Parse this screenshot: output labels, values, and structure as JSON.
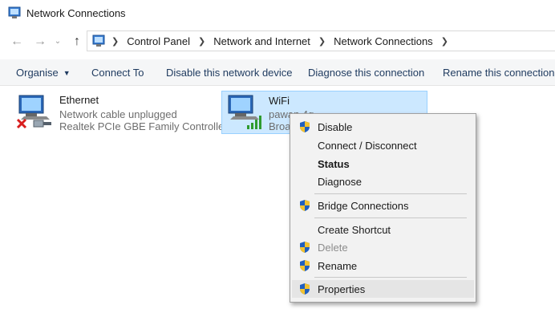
{
  "window": {
    "title": "Network Connections"
  },
  "address": {
    "crumbs": [
      "Control Panel",
      "Network and Internet",
      "Network Connections"
    ]
  },
  "toolbar": {
    "organise": "Organise",
    "connect_to": "Connect To",
    "disable": "Disable this network device",
    "diagnose": "Diagnose this connection",
    "rename": "Rename this connection"
  },
  "connections": {
    "ethernet": {
      "name": "Ethernet",
      "status": "Network cable unplugged",
      "device": "Realtek PCIe GBE Family Controller"
    },
    "wifi": {
      "name": "WiFi",
      "status": "pawan 4g",
      "device": "Broa"
    }
  },
  "context_menu": {
    "disable": "Disable",
    "connect": "Connect / Disconnect",
    "status": "Status",
    "diagnose": "Diagnose",
    "bridge": "Bridge Connections",
    "shortcut": "Create Shortcut",
    "delete": "Delete",
    "rename": "Rename",
    "properties": "Properties"
  },
  "colors": {
    "selection": "#cce8ff",
    "toolbar_text": "#1e3a5f",
    "shield_blue": "#1f5fbf",
    "shield_gold": "#f2c230"
  },
  "icons": [
    "control-panel-icon",
    "back-arrow-icon",
    "forward-arrow-icon",
    "up-arrow-icon",
    "network-computer-icon",
    "red-x-icon",
    "cable-icon",
    "signal-bars-icon",
    "uac-shield-icon"
  ]
}
